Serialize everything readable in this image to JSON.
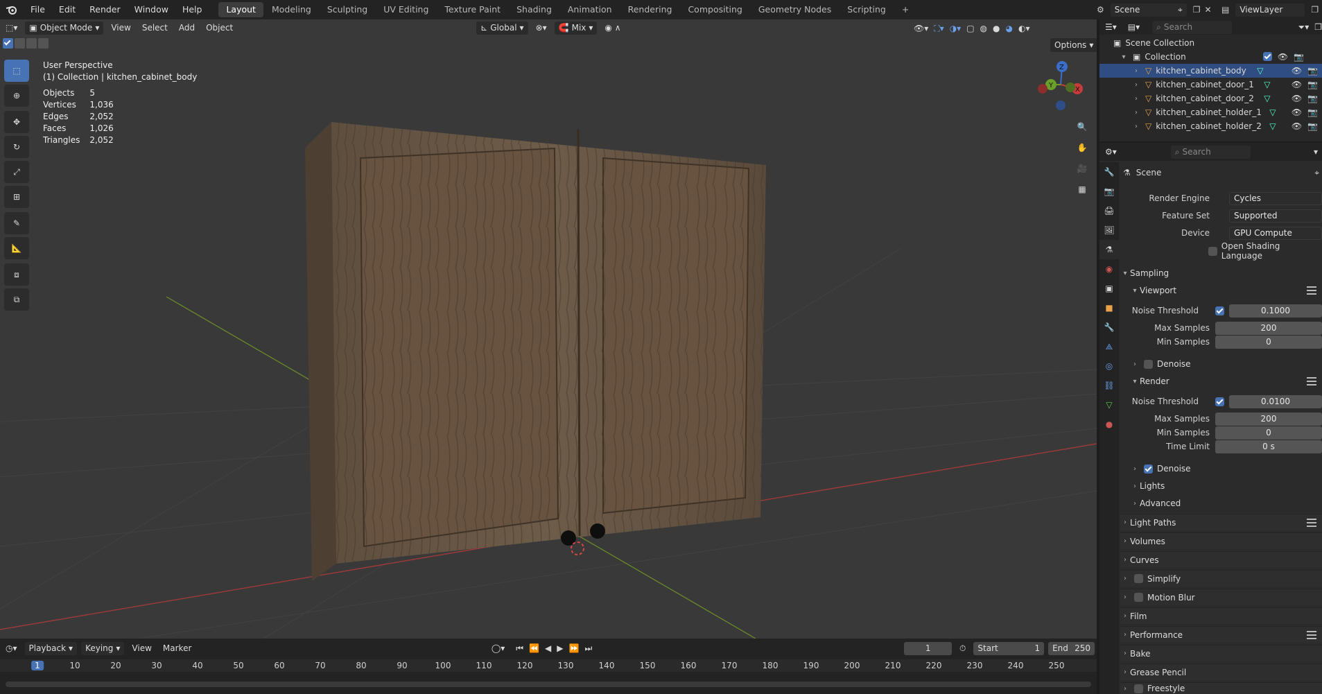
{
  "menu": [
    "File",
    "Edit",
    "Render",
    "Window",
    "Help"
  ],
  "workspaces": [
    "Layout",
    "Modeling",
    "Sculpting",
    "UV Editing",
    "Texture Paint",
    "Shading",
    "Animation",
    "Rendering",
    "Compositing",
    "Geometry Nodes",
    "Scripting"
  ],
  "active_workspace": "Layout",
  "scene_name": "Scene",
  "view_layer": "ViewLayer",
  "viewport": {
    "mode": "Object Mode",
    "menus": [
      "View",
      "Select",
      "Add",
      "Object"
    ],
    "orientation": "Global",
    "snap_mode": "Mix",
    "options_label": "Options",
    "view_name": "User Perspective",
    "collection_line": "(1) Collection | kitchen_cabinet_body",
    "stats": [
      {
        "label": "Objects",
        "value": "5"
      },
      {
        "label": "Vertices",
        "value": "1,036"
      },
      {
        "label": "Edges",
        "value": "2,052"
      },
      {
        "label": "Faces",
        "value": "1,026"
      },
      {
        "label": "Triangles",
        "value": "2,052"
      }
    ],
    "gizmo": {
      "z": "Z",
      "y": "Y",
      "x": "X"
    }
  },
  "timeline": {
    "menus": [
      "Playback",
      "Keying",
      "View",
      "Marker"
    ],
    "current_frame": "1",
    "start_label": "Start",
    "start": "1",
    "end_label": "End",
    "end": "250",
    "ticks": [
      "1",
      "10",
      "20",
      "30",
      "40",
      "50",
      "60",
      "70",
      "80",
      "90",
      "100",
      "110",
      "120",
      "130",
      "140",
      "150",
      "160",
      "170",
      "180",
      "190",
      "200",
      "210",
      "220",
      "230",
      "240",
      "250"
    ]
  },
  "outliner": {
    "search_placeholder": "Search",
    "scene_collection": "Scene Collection",
    "collection": "Collection",
    "objects": [
      "kitchen_cabinet_body",
      "kitchen_cabinet_door_1",
      "kitchen_cabinet_door_2",
      "kitchen_cabinet_holder_1",
      "kitchen_cabinet_holder_2"
    ]
  },
  "properties": {
    "search_placeholder": "Search",
    "context": "Scene",
    "render_engine_label": "Render Engine",
    "render_engine": "Cycles",
    "feature_set_label": "Feature Set",
    "feature_set": "Supported",
    "device_label": "Device",
    "device": "GPU Compute",
    "osl_label": "Open Shading Language",
    "sampling": "Sampling",
    "viewport_sub": "Viewport",
    "noise_threshold_label": "Noise Threshold",
    "viewport_noise": "0.1000",
    "max_samples_label": "Max Samples",
    "viewport_max": "200",
    "min_samples_label": "Min Samples",
    "viewport_min": "0",
    "denoise_label": "Denoise",
    "render_sub": "Render",
    "render_noise": "0.0100",
    "render_max": "200",
    "render_min": "0",
    "time_limit_label": "Time Limit",
    "time_limit": "0 s",
    "lights": "Lights",
    "advanced": "Advanced",
    "panels": [
      "Light Paths",
      "Volumes",
      "Curves",
      "Simplify",
      "Motion Blur",
      "Film",
      "Performance",
      "Bake",
      "Grease Pencil",
      "Freestyle"
    ]
  }
}
